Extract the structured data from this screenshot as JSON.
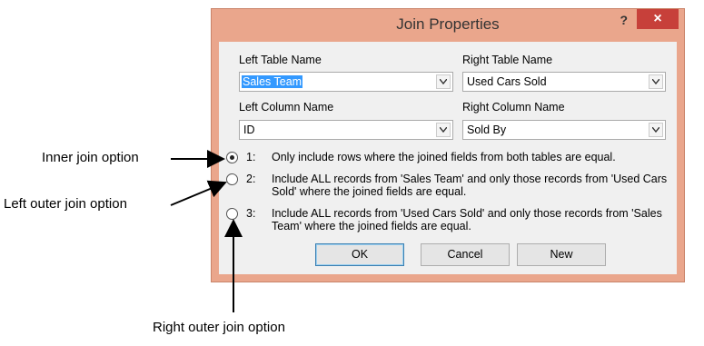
{
  "dialog": {
    "title": "Join Properties",
    "help_label": "?",
    "close_label": "×",
    "left_table": {
      "label": "Left Table Name",
      "value": "Sales Team"
    },
    "right_table": {
      "label": "Right Table Name",
      "value": "Used Cars Sold"
    },
    "left_column": {
      "label": "Left Column Name",
      "value": "ID"
    },
    "right_column": {
      "label": "Right Column Name",
      "value": "Sold By"
    },
    "options": [
      {
        "number": "1:",
        "text": "Only include rows where the joined fields from both tables are equal.",
        "selected": true
      },
      {
        "number": "2:",
        "text": "Include ALL records from 'Sales Team' and only those records from 'Used Cars Sold' where the joined fields are equal.",
        "selected": false
      },
      {
        "number": "3:",
        "text": "Include ALL records from 'Used Cars Sold' and only those records from 'Sales Team' where the joined fields are equal.",
        "selected": false
      }
    ],
    "buttons": {
      "ok": "OK",
      "cancel": "Cancel",
      "new": "New"
    }
  },
  "annotations": {
    "inner": "Inner join option",
    "left_outer": "Left outer join option",
    "right_outer": "Right outer join option"
  },
  "colors": {
    "frame": "#eaa68c",
    "close_button": "#c7403a",
    "selection": "#3399ff"
  }
}
